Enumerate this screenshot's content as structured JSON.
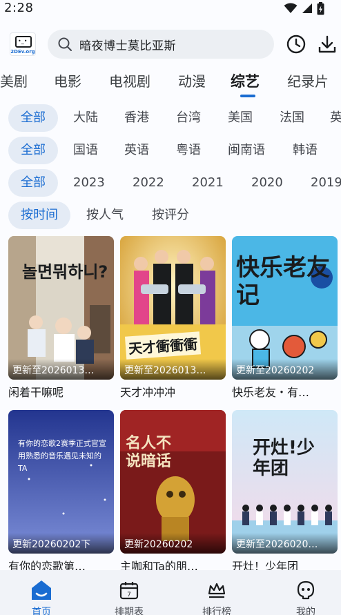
{
  "status_bar": {
    "time": "2:28"
  },
  "header": {
    "logo_text": "2DEv.org",
    "search_placeholder": "暗夜博士莫比亚斯"
  },
  "category_tabs": [
    "美剧",
    "电影",
    "电视剧",
    "动漫",
    "综艺",
    "纪录片"
  ],
  "active_category": "综艺",
  "filters": {
    "region": [
      "全部",
      "大陆",
      "香港",
      "台湾",
      "美国",
      "法国",
      "英"
    ],
    "language": [
      "全部",
      "国语",
      "英语",
      "粤语",
      "闽南语",
      "韩语"
    ],
    "year": [
      "全部",
      "2023",
      "2022",
      "2021",
      "2020",
      "2019"
    ],
    "sort": [
      "按时间",
      "按人气",
      "按评分"
    ]
  },
  "items": [
    {
      "update": "更新至2026013…",
      "title": "闲着干嘛呢",
      "poster_text": "놀면뭐하니?"
    },
    {
      "update": "更新至2026013…",
      "title": "天才冲冲冲",
      "poster_text": "天才衝衝衝"
    },
    {
      "update": "更新至20260202",
      "title": "快乐老友・有…",
      "poster_text": "快乐老友记"
    },
    {
      "update": "更新20260202下",
      "title": "有你的恋歌第…",
      "poster_text": "有你的恋歌2赛季正式官宣 用熟悉的音乐遇见未知的TA"
    },
    {
      "update": "更新20260202",
      "title": "主咖和Ta的朋…",
      "poster_text": "名人不说暗话"
    },
    {
      "update": "更新至2026020…",
      "title": "开灶！少年团",
      "poster_text": "开灶!少年团"
    }
  ],
  "bottom_nav": [
    "首页",
    "排期表",
    "排行榜",
    "我的"
  ],
  "colors": {
    "accent": "#1a6cd1",
    "chip_bg": "#e4ebf5",
    "search_bg": "#eceff3"
  }
}
